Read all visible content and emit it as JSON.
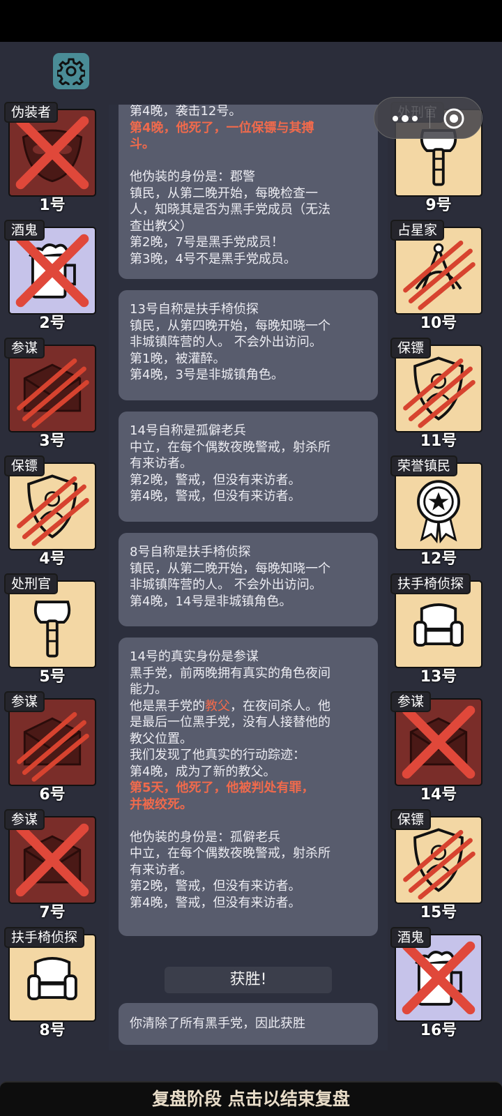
{
  "log": {
    "msg1": {
      "line0": "第4晚，袭击12号。",
      "red1": "第4晚，他死了，一位保镖与其搏",
      "red2": "斗。",
      "l1": "他伪装的身份是：郡警",
      "l2": "镇民，从第二晚开始，每晚检查一",
      "l3": "人，知晓其是否为黑手党成员（无法",
      "l4": "查出教父）",
      "l5": "第2晚，7号是黑手党成员！",
      "l6": "第3晚，4号不是黑手党成员。"
    },
    "msg2": {
      "l1": "13号自称是扶手椅侦探",
      "l2": "镇民，从第四晚开始，每晚知晓一个",
      "l3": "非城镇阵营的人。 不会外出访问。",
      "l4": "第1晚，被灌醉。",
      "l5": "第4晚，3号是非城镇角色。"
    },
    "msg3": {
      "l1": "14号自称是孤僻老兵",
      "l2": "中立，在每个偶数夜晚警戒，射杀所",
      "l3": "有来访者。",
      "l4": "第2晚，警戒，但没有来访者。",
      "l5": "第4晚，警戒，但没有来访者。"
    },
    "msg4": {
      "l1": "8号自称是扶手椅侦探",
      "l2": "镇民，从第二晚开始，每晚知晓一个",
      "l3": "非城镇阵营的人。 不会外出访问。",
      "l4": "第4晚，14号是非城镇角色。"
    },
    "msg5": {
      "l1": "14号的真实身份是参谋",
      "l2": "黑手党，前两晚拥有真实的角色夜间",
      "l3": "能力。",
      "l4a": "他是黑手党的",
      "l4b": "教父",
      "l4c": "，在夜间杀人。他",
      "l5": "是最后一位黑手党，没有人接替他的",
      "l6": "教父位置。",
      "l7": "我们发现了他真实的行动踪迹：",
      "l8": "第4晚，成为了新的教父。",
      "red1": "第5天，他死了，他被判处有罪，",
      "red2": "并被绞死。",
      "l9": "他伪装的身份是：孤僻老兵",
      "l10": "中立，在每个偶数夜晚警戒，射杀所",
      "l11": "有来访者。",
      "l12": "第2晚，警戒，但没有来访者。",
      "l13": "第4晚，警戒，但没有来访者。"
    },
    "victory_label": "获胜!",
    "result": "你清除了所有黑手党，因此获胜"
  },
  "players": [
    {
      "role": "伪装者",
      "num": "1号",
      "icon": "mask-icon",
      "status": "crossed"
    },
    {
      "role": "酒鬼",
      "num": "2号",
      "icon": "beer-mug-icon",
      "status": "crossed"
    },
    {
      "role": "参谋",
      "num": "3号",
      "icon": "envelope-icon",
      "status": "clawed"
    },
    {
      "role": "保镖",
      "num": "4号",
      "icon": "shield-icon",
      "status": "clawed"
    },
    {
      "role": "处刑官",
      "num": "5号",
      "icon": "axe-icon",
      "status": "alive"
    },
    {
      "role": "参谋",
      "num": "6号",
      "icon": "envelope-icon",
      "status": "clawed"
    },
    {
      "role": "参谋",
      "num": "7号",
      "icon": "envelope-icon",
      "status": "crossed"
    },
    {
      "role": "扶手椅侦探",
      "num": "8号",
      "icon": "armchair-icon",
      "status": "alive"
    },
    {
      "role": "处刑官",
      "num": "9号",
      "icon": "axe-icon",
      "status": "alive"
    },
    {
      "role": "占星家",
      "num": "10号",
      "icon": "sextant-icon",
      "status": "clawed"
    },
    {
      "role": "保镖",
      "num": "11号",
      "icon": "shield-icon",
      "status": "clawed"
    },
    {
      "role": "荣誉镇民",
      "num": "12号",
      "icon": "medal-icon",
      "status": "alive"
    },
    {
      "role": "扶手椅侦探",
      "num": "13号",
      "icon": "armchair-icon",
      "status": "alive"
    },
    {
      "role": "参谋",
      "num": "14号",
      "icon": "envelope-icon",
      "status": "crossed"
    },
    {
      "role": "保镖",
      "num": "15号",
      "icon": "shield-icon",
      "status": "clawed"
    },
    {
      "role": "酒鬼",
      "num": "16号",
      "icon": "beer-mug-icon",
      "status": "crossed"
    }
  ],
  "bottom_bar": "复盘阶段 点击以结束复盘",
  "colors": {
    "cream": "#f3d7a4",
    "maroon": "#7a2d29",
    "lavender": "#c6c3ea",
    "highlight": "#f06a4c"
  }
}
